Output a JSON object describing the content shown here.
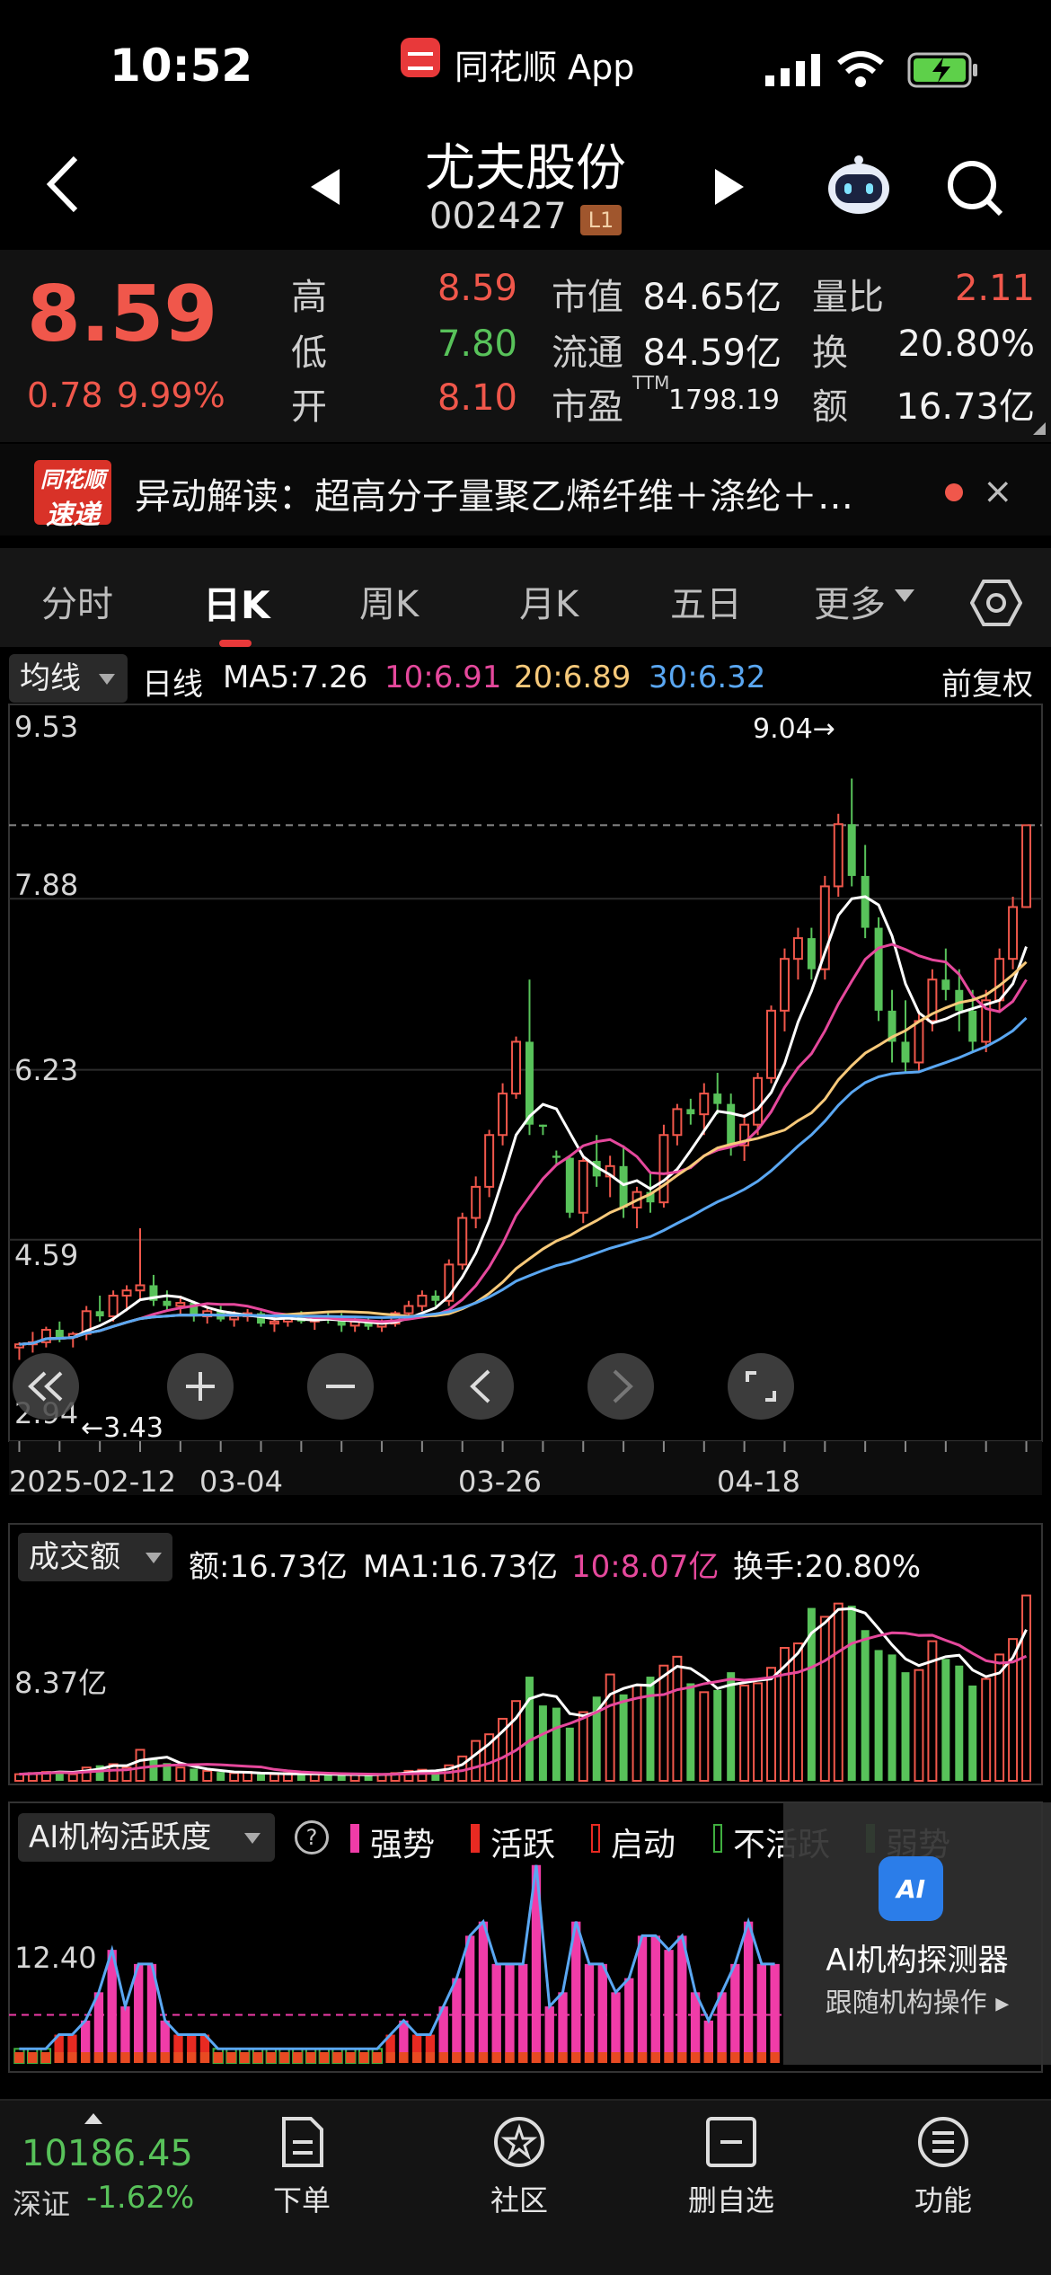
{
  "status_bar": {
    "time": "10:52",
    "app_name": "同花顺 App"
  },
  "nav": {
    "stock_name": "尤夫股份",
    "stock_code": "002427",
    "level": "L1"
  },
  "quote": {
    "price": "8.59",
    "change": "0.78",
    "change_pct": "9.99%",
    "rows": [
      {
        "l1": "高",
        "v1": "8.59",
        "l2": "市值",
        "v2": "84.65亿",
        "l3": "量比",
        "v3": "2.11"
      },
      {
        "l1": "低",
        "v1": "7.80",
        "l2": "流通",
        "v2": "84.59亿",
        "l3": "换",
        "v3": "20.80%"
      },
      {
        "l1": "开",
        "v1": "8.10",
        "l2": "市盈",
        "l2sup": "TTM",
        "v2": "1798.19",
        "l3": "额",
        "v3": "16.73亿"
      }
    ]
  },
  "news": {
    "logo_top": "同花顺",
    "logo_bottom": "速递",
    "text": "异动解读：超高分子量聚乙烯纤维＋涤纶＋…",
    "close": "×"
  },
  "tabs": [
    "分时",
    "日K",
    "周K",
    "月K",
    "五日",
    "更多"
  ],
  "ma_legend": {
    "selector": "均线",
    "kind": "日线",
    "ma5": "MA5:7.26",
    "ma10": "10:6.91",
    "ma20": "20:6.89",
    "ma30": "30:6.32",
    "adjust": "前复权"
  },
  "colors": {
    "up": "#f0574b",
    "down": "#58c25a",
    "ma5": "#ffffff",
    "ma10": "#e5489c",
    "ma20": "#f7c97a",
    "ma30": "#5aa7f2",
    "volma10": "#e5489c",
    "ai_strong": "#f03ca8"
  },
  "kline": {
    "y_ticks": [
      "9.53",
      "7.88",
      "6.23",
      "4.59",
      "2.94"
    ],
    "max_label": "9.04→",
    "min_label": "←3.43",
    "date_labels": [
      "2025-02-12",
      "03-04",
      "03-26",
      "04-18"
    ]
  },
  "volume": {
    "selector": "成交额",
    "amount": "额:16.73亿",
    "ma1": "MA1:16.73亿",
    "ma10": "10:8.07亿",
    "turnover": "换手:20.80%",
    "y_label": "8.37亿"
  },
  "ai_activity": {
    "selector": "AI机构活跃度",
    "help": "?",
    "legend": [
      "强势",
      "活跃",
      "启动",
      "不活跃",
      "弱势"
    ],
    "y_label": "12.40",
    "panel_title": "AI机构探测器",
    "panel_sub": "跟随机构操作 ▸",
    "logo": "AI"
  },
  "chart_data": {
    "type": "candlestick",
    "title": "",
    "x_labels": [
      "2025-02-12",
      "03-04",
      "03-26",
      "04-18"
    ],
    "ylim": [
      2.94,
      9.53
    ],
    "candles": [
      [
        3.55,
        3.6,
        3.43,
        3.58
      ],
      [
        3.58,
        3.7,
        3.5,
        3.6
      ],
      [
        3.6,
        3.75,
        3.55,
        3.72
      ],
      [
        3.72,
        3.8,
        3.6,
        3.65
      ],
      [
        3.65,
        3.7,
        3.55,
        3.68
      ],
      [
        3.68,
        3.95,
        3.62,
        3.9
      ],
      [
        3.9,
        4.05,
        3.8,
        3.85
      ],
      [
        3.85,
        4.1,
        3.8,
        4.05
      ],
      [
        4.05,
        4.15,
        3.9,
        4.1
      ],
      [
        4.1,
        4.7,
        4.0,
        4.15
      ],
      [
        4.15,
        4.25,
        3.95,
        4.0
      ],
      [
        4.0,
        4.1,
        3.9,
        3.95
      ],
      [
        3.95,
        4.05,
        3.85,
        3.98
      ],
      [
        3.98,
        4.0,
        3.8,
        3.85
      ],
      [
        3.85,
        3.95,
        3.78,
        3.9
      ],
      [
        3.9,
        3.95,
        3.8,
        3.82
      ],
      [
        3.82,
        3.9,
        3.75,
        3.85
      ],
      [
        3.85,
        3.92,
        3.8,
        3.88
      ],
      [
        3.88,
        3.9,
        3.75,
        3.78
      ],
      [
        3.78,
        3.85,
        3.7,
        3.8
      ],
      [
        3.8,
        3.88,
        3.75,
        3.85
      ],
      [
        3.85,
        3.9,
        3.78,
        3.8
      ],
      [
        3.8,
        3.86,
        3.72,
        3.84
      ],
      [
        3.84,
        3.9,
        3.78,
        3.82
      ],
      [
        3.82,
        3.88,
        3.7,
        3.76
      ],
      [
        3.76,
        3.84,
        3.7,
        3.8
      ],
      [
        3.8,
        3.85,
        3.72,
        3.75
      ],
      [
        3.75,
        3.82,
        3.7,
        3.78
      ],
      [
        3.78,
        3.9,
        3.75,
        3.88
      ],
      [
        3.88,
        4.0,
        3.82,
        3.95
      ],
      [
        3.95,
        4.1,
        3.9,
        4.05
      ],
      [
        4.05,
        4.1,
        3.95,
        4.0
      ],
      [
        4.0,
        4.4,
        3.95,
        4.35
      ],
      [
        4.35,
        4.85,
        4.3,
        4.8
      ],
      [
        4.8,
        5.2,
        4.7,
        5.1
      ],
      [
        5.1,
        5.65,
        5.0,
        5.6
      ],
      [
        5.6,
        6.1,
        5.5,
        6.0
      ],
      [
        6.0,
        6.55,
        5.95,
        6.5
      ],
      [
        6.5,
        7.1,
        5.6,
        5.7
      ],
      [
        5.7,
        5.7,
        5.6,
        5.68
      ],
      [
        5.4,
        5.45,
        5.3,
        5.38
      ],
      [
        5.38,
        5.4,
        4.8,
        4.85
      ],
      [
        4.85,
        5.4,
        4.75,
        5.35
      ],
      [
        5.35,
        5.6,
        5.1,
        5.2
      ],
      [
        5.2,
        5.4,
        5.0,
        5.3
      ],
      [
        5.3,
        5.5,
        4.8,
        4.9
      ],
      [
        4.9,
        5.1,
        4.7,
        5.05
      ],
      [
        5.05,
        5.25,
        4.85,
        4.95
      ],
      [
        4.95,
        5.7,
        4.9,
        5.6
      ],
      [
        5.6,
        5.9,
        5.5,
        5.85
      ],
      [
        5.85,
        5.95,
        5.7,
        5.8
      ],
      [
        5.8,
        6.1,
        5.6,
        6.0
      ],
      [
        6.0,
        6.2,
        5.8,
        5.9
      ],
      [
        5.9,
        6.0,
        5.4,
        5.5
      ],
      [
        5.5,
        5.8,
        5.35,
        5.7
      ],
      [
        5.7,
        6.2,
        5.6,
        6.15
      ],
      [
        6.15,
        6.85,
        6.1,
        6.8
      ],
      [
        6.8,
        7.4,
        6.6,
        7.3
      ],
      [
        7.3,
        7.6,
        7.1,
        7.5
      ],
      [
        7.5,
        7.6,
        7.1,
        7.2
      ],
      [
        7.2,
        8.1,
        7.1,
        8.0
      ],
      [
        8.0,
        8.7,
        7.9,
        8.6
      ],
      [
        8.6,
        9.04,
        8.0,
        8.1
      ],
      [
        8.1,
        8.4,
        7.5,
        7.6
      ],
      [
        7.6,
        7.7,
        6.7,
        6.8
      ],
      [
        6.8,
        7.0,
        6.3,
        6.5
      ],
      [
        6.5,
        6.9,
        6.2,
        6.3
      ],
      [
        6.3,
        6.8,
        6.2,
        6.7
      ],
      [
        6.7,
        7.2,
        6.6,
        7.1
      ],
      [
        7.1,
        7.4,
        6.9,
        7.0
      ],
      [
        7.0,
        7.2,
        6.6,
        6.8
      ],
      [
        6.8,
        7.0,
        6.4,
        6.5
      ],
      [
        6.5,
        7.0,
        6.4,
        6.9
      ],
      [
        6.9,
        7.4,
        6.8,
        7.3
      ],
      [
        7.3,
        7.9,
        7.2,
        7.8
      ],
      [
        7.8,
        8.59,
        7.8,
        8.59
      ]
    ],
    "volume": [
      0.6,
      0.7,
      0.8,
      0.9,
      0.6,
      1.2,
      1.4,
      1.5,
      1.2,
      2.8,
      2.0,
      1.6,
      1.2,
      1.1,
      0.9,
      0.8,
      0.7,
      0.8,
      0.6,
      0.6,
      0.7,
      0.6,
      0.6,
      0.6,
      0.5,
      0.6,
      0.5,
      0.6,
      0.7,
      0.9,
      1.0,
      0.8,
      1.4,
      2.2,
      3.6,
      4.2,
      5.6,
      7.2,
      9.4,
      6.8,
      6.6,
      4.8,
      6.2,
      7.6,
      9.6,
      7.8,
      8.6,
      9.4,
      10.4,
      11.2,
      8.8,
      8.0,
      8.2,
      9.8,
      8.6,
      8.8,
      10.2,
      12.0,
      12.4,
      15.6,
      14.8,
      16.0,
      15.8,
      13.6,
      11.8,
      11.4,
      9.8,
      10.0,
      12.6,
      11.0,
      10.4,
      8.6,
      9.2,
      11.4,
      12.8,
      16.73
    ],
    "ai_activity": [
      1,
      1,
      1,
      2,
      2,
      3,
      5,
      8,
      4,
      7,
      7,
      3,
      2,
      2,
      2,
      1,
      1,
      1,
      1,
      1,
      1,
      1,
      1,
      1,
      1,
      1,
      1,
      1,
      2,
      3,
      2,
      2,
      4,
      6,
      9,
      10,
      7,
      7,
      7,
      14,
      4,
      5,
      10,
      7,
      7,
      5,
      6,
      9,
      9,
      8,
      9,
      5,
      3,
      5,
      7,
      10,
      7,
      7
    ]
  },
  "bottom_bar": {
    "index_value": "10186.45",
    "index_name": "深证",
    "index_chg": "-1.62%",
    "items": [
      "下单",
      "社区",
      "删自选",
      "功能"
    ]
  }
}
